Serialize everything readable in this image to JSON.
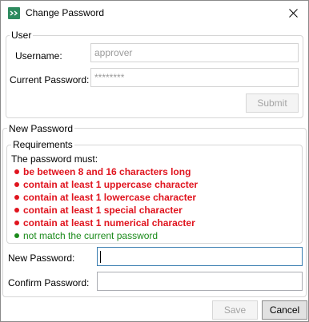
{
  "window": {
    "title": "Change Password",
    "close_icon": "close-icon"
  },
  "user": {
    "legend": "User",
    "username_label": "Username:",
    "username_value": "approver",
    "current_password_label": "Current Password:",
    "current_password_value": "********",
    "submit_label": "Submit"
  },
  "new_password": {
    "legend": "New Password",
    "requirements": {
      "legend": "Requirements",
      "intro": "The password must:",
      "items": [
        {
          "text": "be between 8 and 16 characters long",
          "status": "fail"
        },
        {
          "text": "contain at least 1 uppercase character",
          "status": "fail"
        },
        {
          "text": "contain at least 1 lowercase character",
          "status": "fail"
        },
        {
          "text": "contain at least 1 special character",
          "status": "fail"
        },
        {
          "text": "contain at least 1 numerical character",
          "status": "fail"
        },
        {
          "text": "not match the current password",
          "status": "pass"
        }
      ],
      "fail_color": "#e0141e",
      "pass_color": "#1a8a1a"
    },
    "new_password_label": "New Password:",
    "new_password_value": "",
    "confirm_password_label": "Confirm Password:",
    "confirm_password_value": ""
  },
  "footer": {
    "save_label": "Save",
    "cancel_label": "Cancel"
  }
}
